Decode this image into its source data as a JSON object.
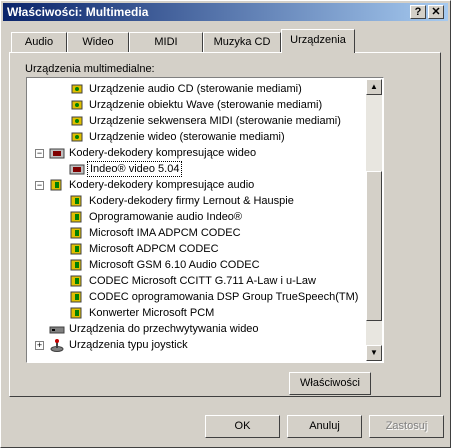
{
  "window": {
    "title": "Właściwości: Multimedia"
  },
  "titlebar_buttons": {
    "help": "?",
    "close": "✕"
  },
  "tabs": [
    "Audio",
    "Wideo",
    "MIDI",
    "Muzyka CD",
    "Urządzenia"
  ],
  "active_tab": "Urządzenia",
  "group_label": "Urządzenia multimedialne:",
  "tree_items": [
    "Urządzenie audio CD (sterowanie mediami)",
    "Urządzenie obiektu Wave (sterowanie mediami)",
    "Urządzenie sekwensera MIDI (sterowanie mediami)",
    "Urządzenie wideo (sterowanie mediami)",
    "Kodery-dekodery kompresujące wideo",
    "Indeo® video 5.04",
    "Kodery-dekodery kompresujące audio",
    "Kodery-dekodery firmy Lernout & Hauspie",
    "Oprogramowanie audio Indeo®",
    "Microsoft IMA ADPCM CODEC",
    "Microsoft ADPCM CODEC",
    "Microsoft GSM 6.10 Audio CODEC",
    "CODEC Microsoft CCITT G.711 A-Law i u-Law",
    "CODEC oprogramowania DSP Group TrueSpeech(TM)",
    "Konwerter Microsoft PCM",
    "Urządzenia do przechwytywania wideo",
    "Urządzenia typu joystick"
  ],
  "expanders": {
    "video_codecs": "−",
    "audio_codecs": "−",
    "joystick": "+"
  },
  "scroll_arrows": {
    "up": "▲",
    "down": "▼"
  },
  "buttons": {
    "properties": "Właściwości",
    "ok": "OK",
    "cancel": "Anuluj",
    "apply": "Zastosuj"
  }
}
